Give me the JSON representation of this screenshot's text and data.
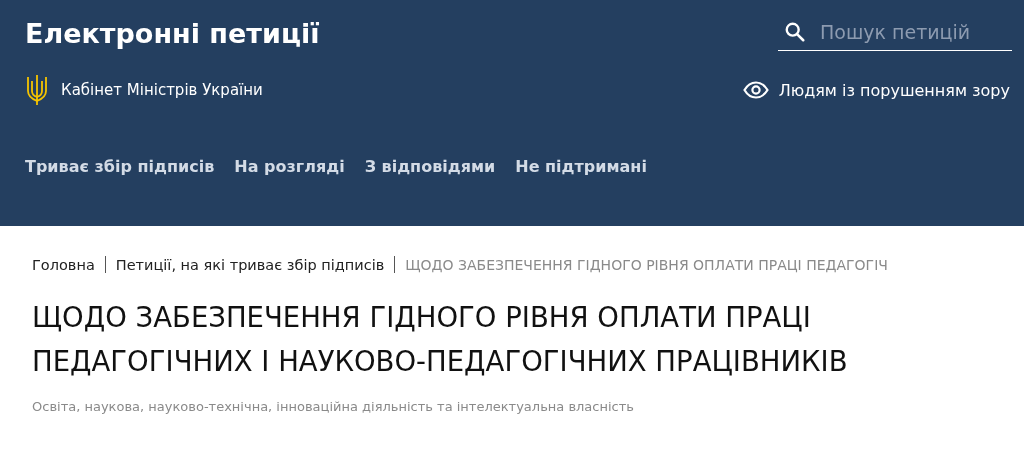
{
  "header": {
    "title": "Електронні петиції",
    "org": "Кабінет Міністрів України",
    "search": {
      "placeholder": "Пошук петицій"
    },
    "accessibility": "Людям із порушенням зору",
    "nav": [
      {
        "label": "Триває збір підписів"
      },
      {
        "label": "На розгляді"
      },
      {
        "label": "З відповідями"
      },
      {
        "label": "Не підтримані"
      }
    ]
  },
  "breadcrumbs": [
    {
      "label": "Головна",
      "current": false
    },
    {
      "label": "Петиції, на які триває збір підписів",
      "current": false
    },
    {
      "label": "ЩОДО ЗАБЕЗПЕЧЕННЯ ГІДНОГО РІВНЯ ОПЛАТИ ПРАЦІ ПЕДАГОГІЧ",
      "current": true
    }
  ],
  "petition": {
    "title": "ЩОДО ЗАБЕЗПЕЧЕННЯ ГІДНОГО РІВНЯ ОПЛАТИ ПРАЦІ ПЕДАГОГІЧНИХ І НАУКОВО-ПЕДАГОГІЧНИХ ПРАЦІВНИКІВ",
    "category": "Освіта, наукова, науково-технічна, інноваційна діяльність та інтелектуальна власність"
  }
}
